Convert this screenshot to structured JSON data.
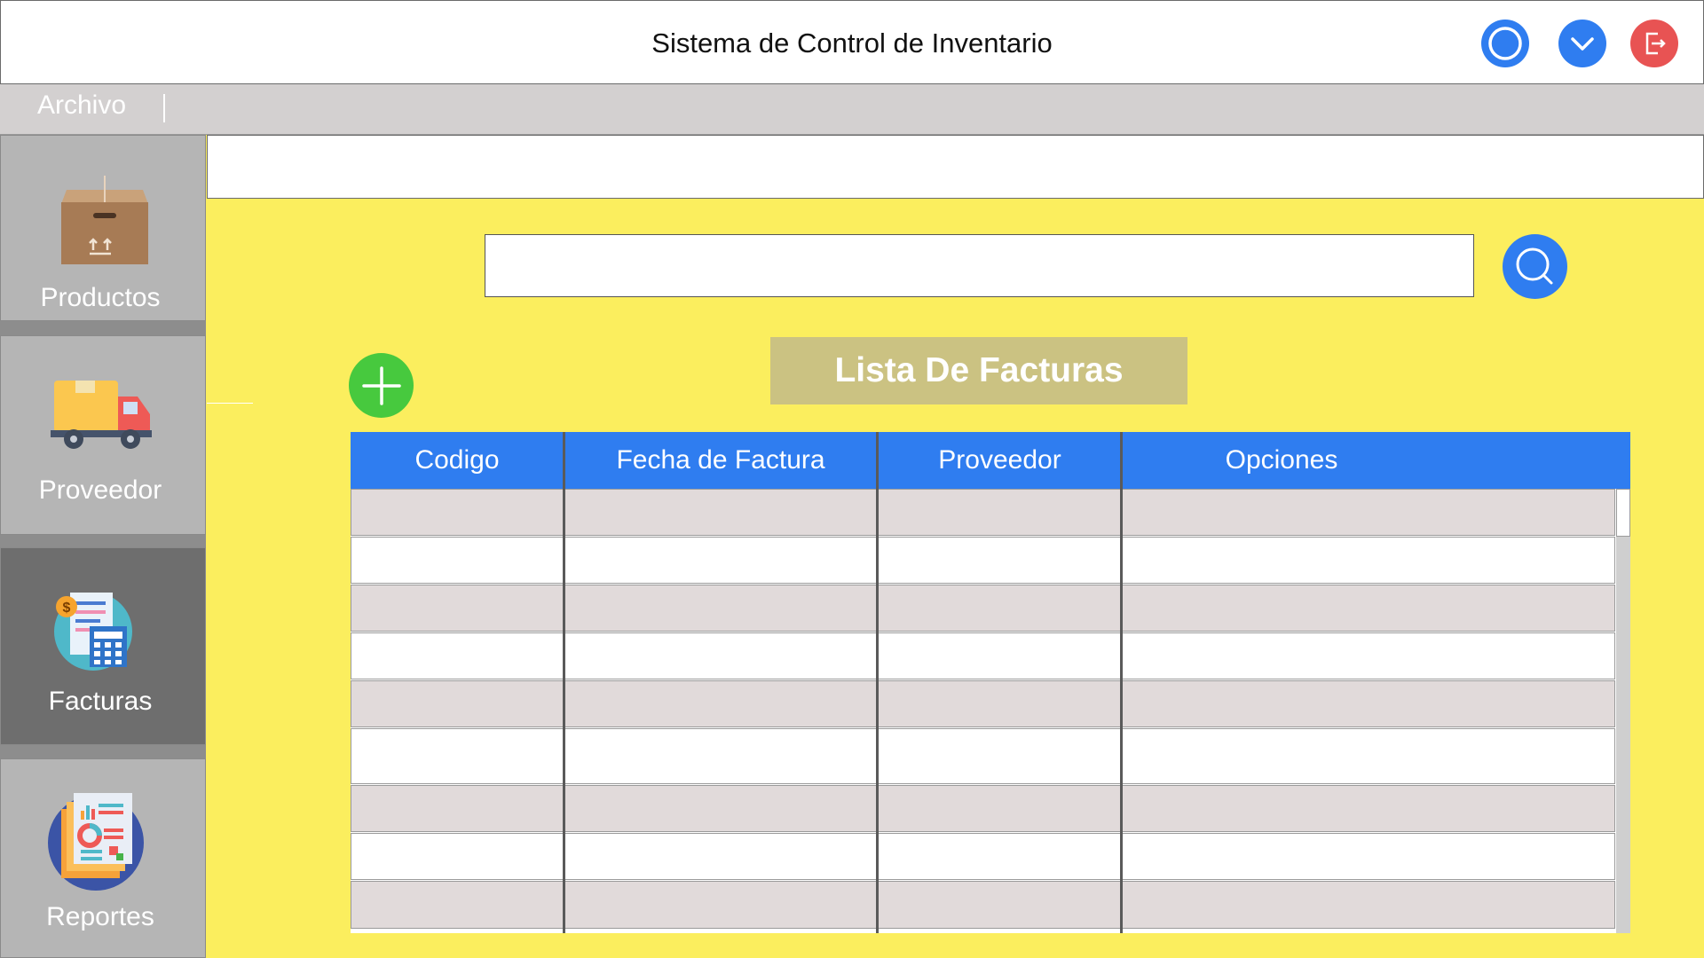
{
  "window": {
    "title": "Sistema de Control de Inventario"
  },
  "menubar": {
    "items": [
      {
        "label": "Archivo"
      }
    ]
  },
  "sidebar": {
    "items": [
      {
        "label": "Productos",
        "icon": "box-icon"
      },
      {
        "label": "Proveedor",
        "icon": "truck-icon"
      },
      {
        "label": "Facturas",
        "icon": "invoice-icon",
        "active": true
      },
      {
        "label": "Reportes",
        "icon": "report-icon"
      }
    ]
  },
  "main": {
    "search": {
      "value": "",
      "placeholder": ""
    },
    "list_title": "Lista De Facturas",
    "table": {
      "columns": [
        "Codigo",
        "Fecha de Factura",
        "Proveedor",
        "Opciones"
      ],
      "rows": [
        [
          "",
          "",
          "",
          ""
        ],
        [
          "",
          "",
          "",
          ""
        ],
        [
          "",
          "",
          "",
          ""
        ],
        [
          "",
          "",
          "",
          ""
        ],
        [
          "",
          "",
          "",
          ""
        ],
        [
          "",
          "",
          "",
          ""
        ],
        [
          "",
          "",
          "",
          ""
        ],
        [
          "",
          "",
          "",
          ""
        ],
        [
          "",
          "",
          "",
          ""
        ]
      ]
    }
  },
  "colors": {
    "accent_blue": "#2f7df0",
    "close_red": "#e85353",
    "add_green": "#47c93e",
    "background_yellow": "#fbee5e",
    "title_box": "#cbc282",
    "row_alt": "#e1dada"
  }
}
